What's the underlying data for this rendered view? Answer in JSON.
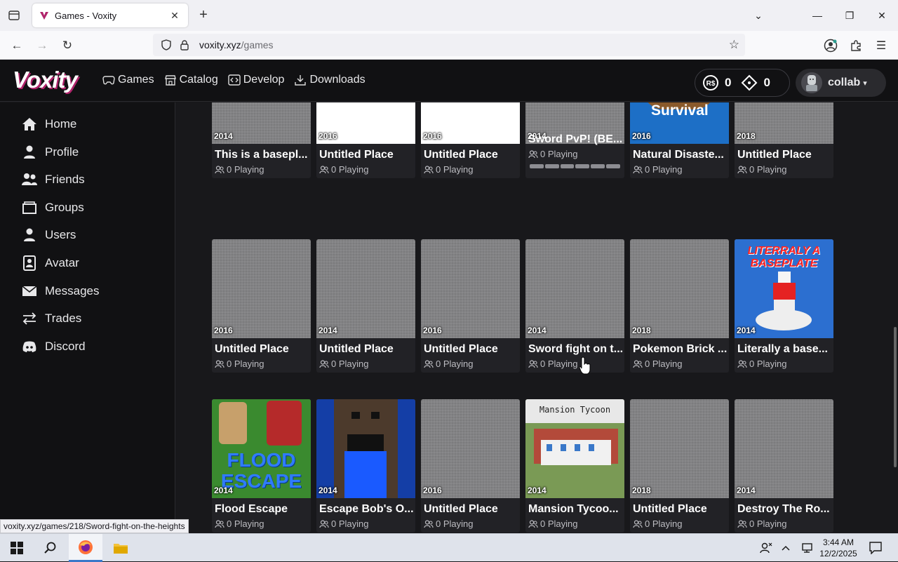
{
  "browser": {
    "tab_title": "Games - Voxity",
    "url_host": "voxity.xyz",
    "url_path": "/games",
    "status_url": "voxity.xyz/games/218/Sword-fight-on-the-heights"
  },
  "site": {
    "logo": "Voxity",
    "nav": [
      {
        "label": "Games",
        "icon": "gamepad-icon"
      },
      {
        "label": "Catalog",
        "icon": "store-icon"
      },
      {
        "label": "Develop",
        "icon": "code-icon"
      },
      {
        "label": "Downloads",
        "icon": "download-icon"
      }
    ],
    "robux": "0",
    "tickets": "0",
    "username": "collab"
  },
  "sidebar": {
    "items": [
      {
        "label": "Home",
        "icon": "home-icon"
      },
      {
        "label": "Profile",
        "icon": "user-icon"
      },
      {
        "label": "Friends",
        "icon": "friends-icon"
      },
      {
        "label": "Groups",
        "icon": "groups-icon"
      },
      {
        "label": "Users",
        "icon": "users-icon"
      },
      {
        "label": "Avatar",
        "icon": "avatar-icon"
      },
      {
        "label": "Messages",
        "icon": "envelope-icon"
      },
      {
        "label": "Trades",
        "icon": "trades-icon"
      },
      {
        "label": "Discord",
        "icon": "discord-icon"
      }
    ]
  },
  "games": [
    {
      "name": "This is a basepl...",
      "year": "2014",
      "playing": "0 Playing",
      "thumb": "gray"
    },
    {
      "name": "Untitled Place",
      "year": "2016",
      "playing": "0 Playing",
      "thumb": "placeholder"
    },
    {
      "name": "Untitled Place",
      "year": "2016",
      "playing": "0 Playing",
      "thumb": "placeholder"
    },
    {
      "name": "Sword PvP! (BE...",
      "year": "2014",
      "playing": "0 Playing",
      "thumb": "gray"
    },
    {
      "name": "Natural Disaste...",
      "year": "2016",
      "playing": "0 Playing",
      "thumb": "survival",
      "thumb_text": "Survival"
    },
    {
      "name": "Untitled Place",
      "year": "2018",
      "playing": "0 Playing",
      "thumb": "gray"
    },
    {
      "name": "Untitled Place",
      "year": "2016",
      "playing": "0 Playing",
      "thumb": "gray"
    },
    {
      "name": "Untitled Place",
      "year": "2014",
      "playing": "0 Playing",
      "thumb": "gray"
    },
    {
      "name": "Untitled Place",
      "year": "2016",
      "playing": "0 Playing",
      "thumb": "gray"
    },
    {
      "name": "Sword fight on t...",
      "year": "2014",
      "playing": "0 Playing",
      "thumb": "gray"
    },
    {
      "name": "Pokemon Brick ...",
      "year": "2018",
      "playing": "0 Playing",
      "thumb": "gray"
    },
    {
      "name": "Literally a base...",
      "year": "2014",
      "playing": "0 Playing",
      "thumb": "literally",
      "thumb_text": "LITERRALY A BASEPLATE"
    },
    {
      "name": "Flood Escape",
      "year": "2014",
      "playing": "0 Playing",
      "thumb": "flood",
      "thumb_text": "FLOOD ESCAPE"
    },
    {
      "name": "Escape Bob's O...",
      "year": "2014",
      "playing": "0 Playing",
      "thumb": "bob"
    },
    {
      "name": "Untitled Place",
      "year": "2016",
      "playing": "0 Playing",
      "thumb": "gray"
    },
    {
      "name": "Mansion Tycoo...",
      "year": "2014",
      "playing": "0 Playing",
      "thumb": "mansion",
      "thumb_text": "Mansion Tycoon"
    },
    {
      "name": "Untitled Place",
      "year": "2018",
      "playing": "0 Playing",
      "thumb": "gray"
    },
    {
      "name": "Destroy The Ro...",
      "year": "2014",
      "playing": "0 Playing",
      "thumb": "gray"
    }
  ],
  "taskbar": {
    "time": "3:44 AM",
    "date": "12/2/2025"
  },
  "colors": {
    "accent": "#b0246b",
    "bg": "#18181b",
    "card": "#222226"
  }
}
